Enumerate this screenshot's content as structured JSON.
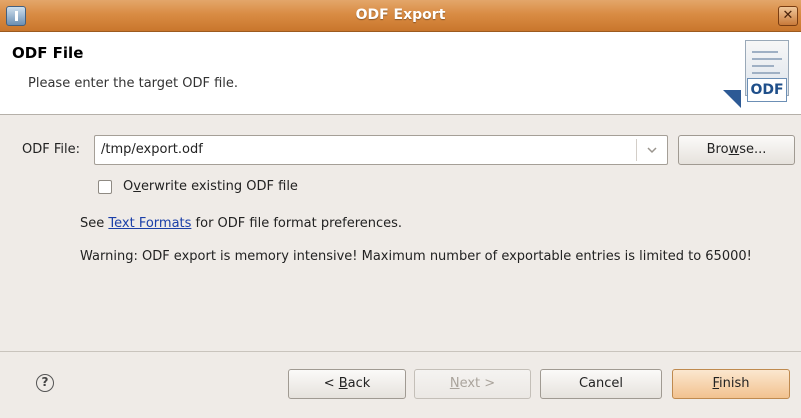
{
  "window": {
    "title": "ODF Export",
    "close_glyph": "✕"
  },
  "header": {
    "title": "ODF File",
    "description": "Please enter the target ODF file.",
    "banner_badge": "ODF"
  },
  "form": {
    "file_label": "ODF File:",
    "file_value": "/tmp/export.odf",
    "browse_pre": "Bro",
    "browse_mn": "w",
    "browse_post": "se...",
    "overwrite_pre": "O",
    "overwrite_mn": "v",
    "overwrite_post": "erwrite existing ODF file",
    "overwrite_checked": false
  },
  "info": {
    "see_pre": "See ",
    "see_link": "Text Formats",
    "see_post": " for ODF file format preferences.",
    "warning": "Warning: ODF export is memory intensive! Maximum number of exportable entries is limited to 65000!"
  },
  "footer": {
    "help_glyph": "?",
    "back_pre": "< ",
    "back_mn": "B",
    "back_post": "ack",
    "next_mn": "N",
    "next_post": "ext >",
    "cancel": "Cancel",
    "finish_mn": "F",
    "finish_post": "inish"
  },
  "icons": [
    "app-icon",
    "close-icon",
    "chevron-down-icon",
    "help-icon",
    "export-document-icon"
  ]
}
